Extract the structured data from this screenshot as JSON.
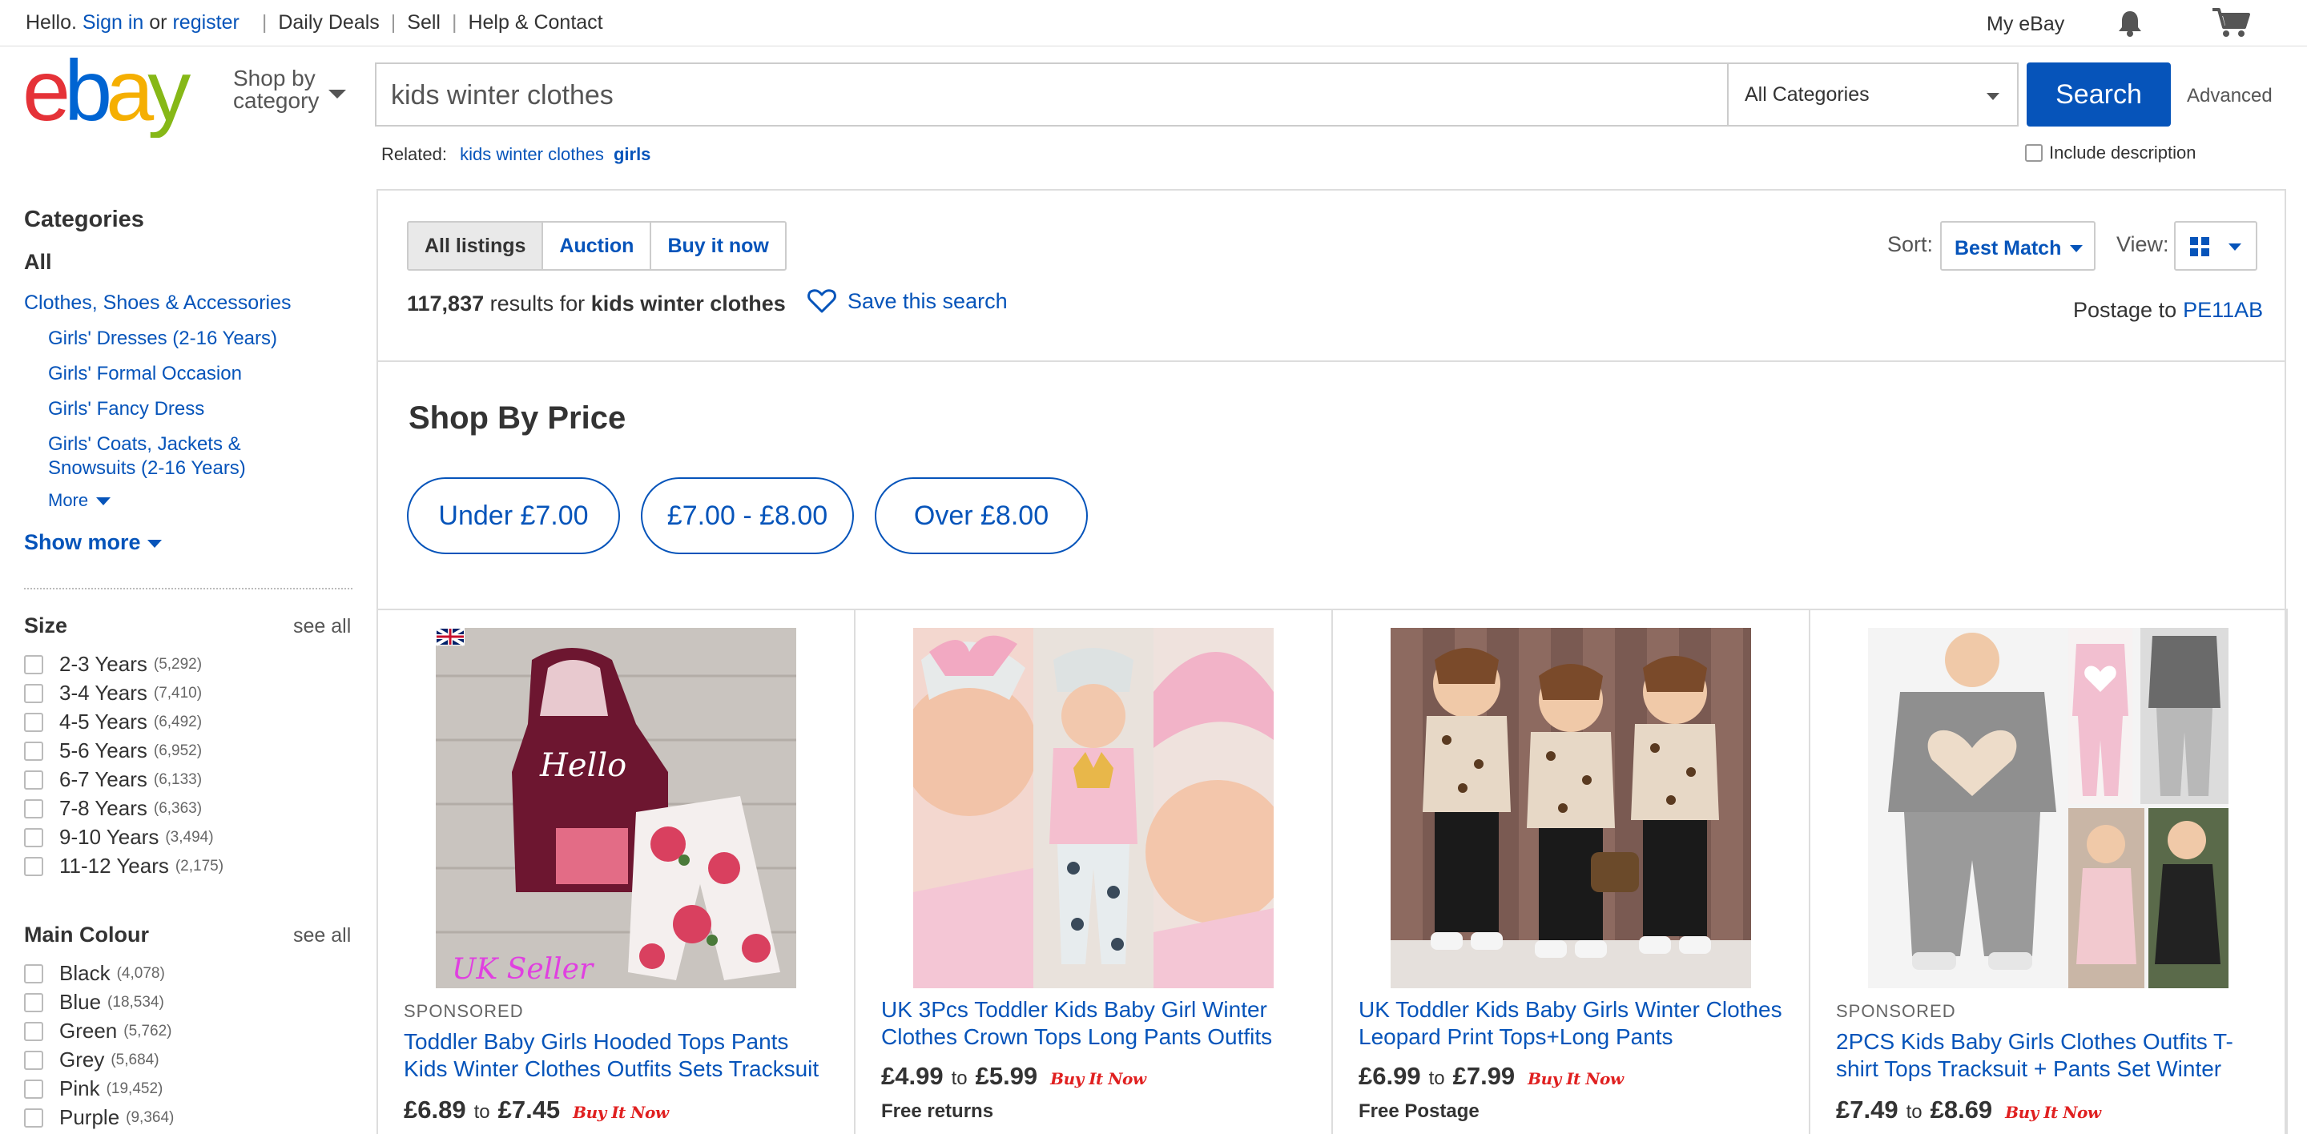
{
  "topbar": {
    "hello": "Hello.",
    "sign_in": "Sign in",
    "or": "or",
    "register": "register",
    "daily_deals": "Daily Deals",
    "sell": "Sell",
    "help": "Help & Contact",
    "my_ebay": "My eBay"
  },
  "header": {
    "shop_by_line1": "Shop by",
    "shop_by_line2": "category",
    "search_value": "kids winter clothes",
    "category": "All Categories",
    "search_button": "Search",
    "advanced": "Advanced",
    "related_label": "Related:",
    "related_link_1": "kids winter clothes",
    "related_link_2": "girls",
    "include_description": "Include description"
  },
  "sidebar": {
    "categories_heading": "Categories",
    "all": "All",
    "level1": "Clothes, Shoes & Accessories",
    "subcats": [
      "Girls' Dresses (2-16 Years)",
      "Girls' Formal Occasion",
      "Girls' Fancy Dress",
      "Girls' Coats, Jackets & Snowsuits (2-16 Years)"
    ],
    "more": "More",
    "show_more": "Show more",
    "size_heading": "Size",
    "see_all": "see all",
    "sizes": [
      {
        "label": "2-3 Years",
        "count": "(5,292)"
      },
      {
        "label": "3-4 Years",
        "count": "(7,410)"
      },
      {
        "label": "4-5 Years",
        "count": "(6,492)"
      },
      {
        "label": "5-6 Years",
        "count": "(6,952)"
      },
      {
        "label": "6-7 Years",
        "count": "(6,133)"
      },
      {
        "label": "7-8 Years",
        "count": "(6,363)"
      },
      {
        "label": "9-10 Years",
        "count": "(3,494)"
      },
      {
        "label": "11-12 Years",
        "count": "(2,175)"
      }
    ],
    "colour_heading": "Main Colour",
    "colours": [
      {
        "label": "Black",
        "count": "(4,078)"
      },
      {
        "label": "Blue",
        "count": "(18,534)"
      },
      {
        "label": "Green",
        "count": "(5,762)"
      },
      {
        "label": "Grey",
        "count": "(5,684)"
      },
      {
        "label": "Pink",
        "count": "(19,452)"
      },
      {
        "label": "Purple",
        "count": "(9,364)"
      }
    ]
  },
  "main": {
    "tabs": [
      "All listings",
      "Auction",
      "Buy it now"
    ],
    "result_count": "117,837",
    "results_for": "results for",
    "query": "kids winter clothes",
    "save_search": "Save this search",
    "sort_label": "Sort:",
    "sort_value": "Best Match",
    "view_label": "View:",
    "postage_to": "Postage to",
    "postcode": "PE11AB",
    "shop_by_price": "Shop By Price",
    "price_pills": [
      "Under £7.00",
      "£7.00 - £8.00",
      "Over £8.00"
    ]
  },
  "products": [
    {
      "sponsored": "SPONSORED",
      "title": "Toddler Baby Girls Hooded Tops Pants Kids Winter Clothes Outfits Sets Tracksuit",
      "price_low": "£6.89",
      "to": "to",
      "price_high": "£7.45",
      "bin": "Buy It Now",
      "shipping": "",
      "watermark": "UK Seller"
    },
    {
      "sponsored": "",
      "title": "UK 3Pcs Toddler Kids Baby Girl Winter Clothes Crown Tops Long Pants Outfits",
      "price_low": "£4.99",
      "to": "to",
      "price_high": "£5.99",
      "bin": "Buy It Now",
      "shipping": "Free returns"
    },
    {
      "sponsored": "",
      "title": "UK Toddler Kids Baby Girls Winter Clothes Leopard Print Tops+Long Pants",
      "price_low": "£6.99",
      "to": "to",
      "price_high": "£7.99",
      "bin": "Buy It Now",
      "shipping": "Free Postage"
    },
    {
      "sponsored": "SPONSORED",
      "title": "2PCS Kids Baby Girls Clothes Outfits T-shirt Tops Tracksuit + Pants Set Winter",
      "price_low": "£7.49",
      "to": "to",
      "price_high": "£8.69",
      "bin": "Buy It Now",
      "shipping": ""
    }
  ],
  "colors": {
    "link": "#0654ba",
    "buy_it_now": "#e02020",
    "border": "#dddddd"
  }
}
